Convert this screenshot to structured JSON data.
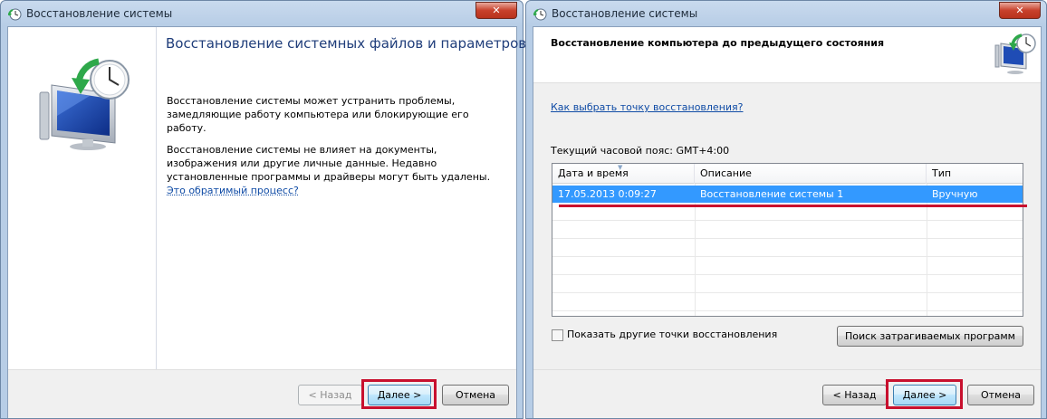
{
  "left_window": {
    "title": "Восстановление системы",
    "close_label": "✕",
    "heading": "Восстановление системных файлов и параметров",
    "para1": "Восстановление системы может устранить проблемы, замедляющие работу компьютера или блокирующие его работу.",
    "para2": "Восстановление системы не влияет на документы, изображения или другие личные данные. Недавно установленные программы и драйверы могут быть удалены.",
    "para2_link": "Это обратимый процесс?",
    "buttons": {
      "back": "< Назад",
      "next": "Далее >",
      "cancel": "Отмена"
    }
  },
  "right_window": {
    "title": "Восстановление системы",
    "close_label": "✕",
    "heading": "Восстановление компьютера до предыдущего состояния",
    "help_link": "Как выбрать точку восстановления?",
    "timezone": "Текущий часовой пояс: GMT+4:00",
    "table": {
      "columns": [
        "Дата и время",
        "Описание",
        "Тип"
      ],
      "rows": [
        [
          "17.05.2013 0:09:27",
          "Восстановление системы 1",
          "Вручную"
        ]
      ]
    },
    "show_more_label": "Показать другие точки восстановления",
    "show_more_checked": false,
    "scan_button": "Поиск затрагиваемых программ",
    "buttons": {
      "back": "< Назад",
      "next": "Далее >",
      "cancel": "Отмена"
    }
  },
  "icons": {
    "title_icon": "system-restore-icon",
    "wizard_icon": "restore-computer-clock-icon"
  },
  "colors": {
    "highlight": "#c8102e",
    "selection": "#3399ff",
    "link": "#0f4ba5"
  }
}
